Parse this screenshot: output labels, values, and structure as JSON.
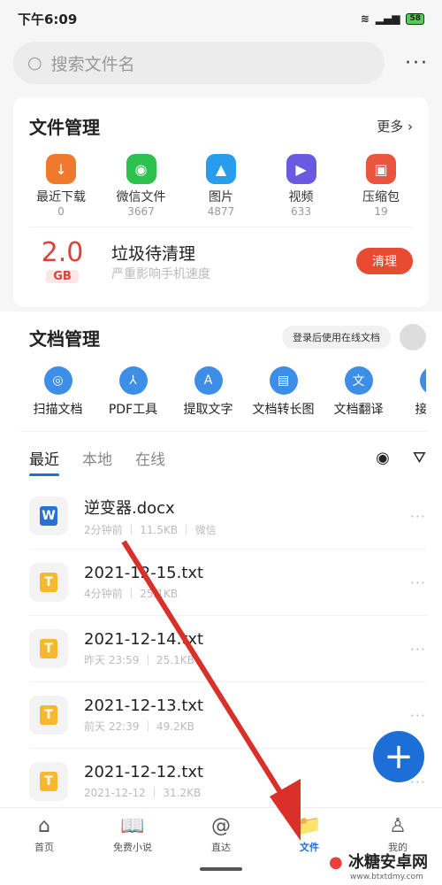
{
  "status": {
    "time": "下午6:09",
    "battery": "58",
    "network": "4G"
  },
  "search": {
    "placeholder": "搜索文件名",
    "more": "···"
  },
  "file_mgmt": {
    "title": "文件管理",
    "more": "更多 ›",
    "categories": [
      {
        "label": "最近下载",
        "count": "0",
        "color": "#f07a2c",
        "icon": "↓"
      },
      {
        "label": "微信文件",
        "count": "3667",
        "color": "#2bc14c",
        "icon": "◉"
      },
      {
        "label": "图片",
        "count": "4877",
        "color": "#2a9cec",
        "icon": "▲"
      },
      {
        "label": "视频",
        "count": "633",
        "color": "#6a5ae0",
        "icon": "▶"
      },
      {
        "label": "压缩包",
        "count": "19",
        "color": "#e9553f",
        "icon": "▣"
      }
    ],
    "junk": {
      "value": "2.0",
      "unit": "GB",
      "title": "垃圾待清理",
      "subtitle": "严重影响手机速度",
      "button": "清理"
    }
  },
  "doc_mgmt": {
    "title": "文档管理",
    "login": "登录后使用在线文档",
    "tools": [
      {
        "label": "扫描文档",
        "icon": "◎"
      },
      {
        "label": "PDF工具",
        "icon": "⅄"
      },
      {
        "label": "提取文字",
        "icon": "A"
      },
      {
        "label": "文档转长图",
        "icon": "▤"
      },
      {
        "label": "文档翻译",
        "icon": "文"
      },
      {
        "label": "接龙统",
        "icon": "▪"
      }
    ],
    "tabs": [
      "最近",
      "本地",
      "在线"
    ],
    "files": [
      {
        "name": "逆变器.docx",
        "time": "2分钟前",
        "size": "11.5KB",
        "source": "微信",
        "type": "W",
        "color": "#2a6fd6"
      },
      {
        "name": "2021-12-15.txt",
        "time": "4分钟前",
        "size": "25.1KB",
        "type": "T",
        "color": "#f5b82e"
      },
      {
        "name": "2021-12-14.txt",
        "time": "昨天 23:59",
        "size": "25.1KB",
        "type": "T",
        "color": "#f5b82e"
      },
      {
        "name": "2021-12-13.txt",
        "time": "前天 22:39",
        "size": "49.2KB",
        "type": "T",
        "color": "#f5b82e"
      },
      {
        "name": "2021-12-12.txt",
        "time": "2021-12-12",
        "size": "31.2KB",
        "type": "T",
        "color": "#f5b82e"
      }
    ]
  },
  "nav": [
    {
      "label": "首页",
      "icon": "⌂"
    },
    {
      "label": "免费小说",
      "icon": "📖"
    },
    {
      "label": "直达",
      "icon": "@"
    },
    {
      "label": "文件",
      "icon": "📁"
    },
    {
      "label": "我的",
      "icon": "♙"
    }
  ],
  "watermark": {
    "text": "冰糖安卓网",
    "url": "www.btxtdmy.com"
  },
  "accent": "#1d6fd8"
}
